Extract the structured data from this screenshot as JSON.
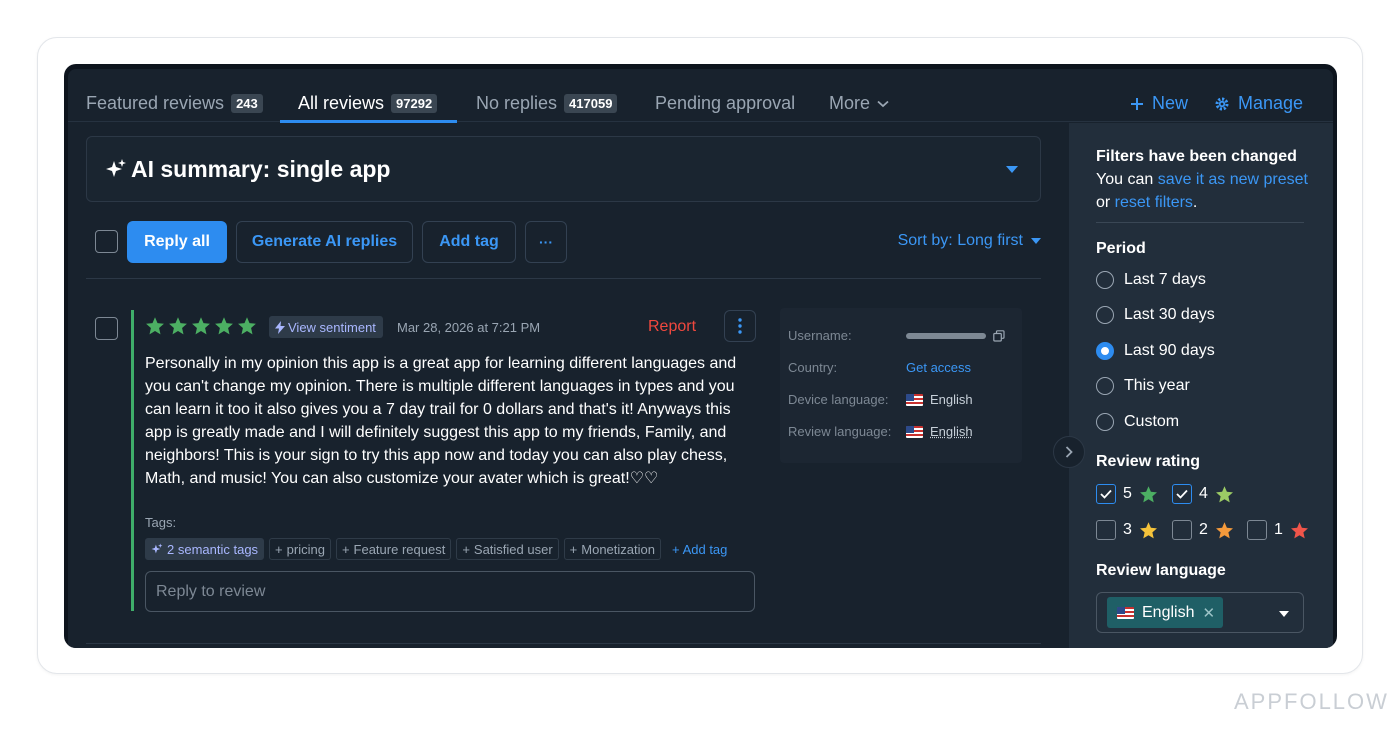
{
  "tabs": [
    {
      "label": "Featured reviews",
      "count": "243"
    },
    {
      "label": "All reviews",
      "count": "97292"
    },
    {
      "label": "No replies",
      "count": "417059"
    },
    {
      "label": "Pending approval"
    },
    {
      "label": "More"
    }
  ],
  "actions": {
    "new": "New",
    "manage": "Manage"
  },
  "ai_summary": {
    "title": "AI summary: single app"
  },
  "toolbar": {
    "reply_all": "Reply all",
    "generate": "Generate AI replies",
    "add_tag": "Add tag",
    "more": "···",
    "sort": "Sort by: Long first"
  },
  "review": {
    "rating": 5,
    "sentiment": "View sentiment",
    "date": "Mar 28, 2026 at 7:21 PM",
    "report": "Report",
    "text": "Personally in my opinion this app is a great app for learning different languages and you can't change my opinion. There is multiple different languages in types and you can learn it too it also gives you a 7 day trail for 0 dollars and that's it! Anyways this app is greatly made and I will definitely suggest this app to my friends, Family, and neighbors! This is your sign to try this app now and today you can also play chess, Math, and music! You can also customize your avater which is great!♡♡",
    "tags_label": "Tags:",
    "tags": {
      "semantic": "2 semantic tags",
      "items": [
        "pricing",
        "Feature request",
        "Satisfied user",
        "Monetization"
      ],
      "add": "Add tag"
    },
    "reply_placeholder": "Reply to review"
  },
  "meta": {
    "username_label": "Username:",
    "country_label": "Country:",
    "country_value": "Get access",
    "device_language_label": "Device language:",
    "device_language_value": "English",
    "review_language_label": "Review language:",
    "review_language_value": "English"
  },
  "sidebar": {
    "notice_title": "Filters have been changed",
    "notice_prefix": "You can ",
    "notice_link1": "save it as new preset",
    "notice_or": "or ",
    "notice_link2": "reset filters",
    "notice_end": ".",
    "period_title": "Period",
    "periods": [
      "Last 7 days",
      "Last 30 days",
      "Last 90 days",
      "This year",
      "Custom"
    ],
    "period_selected": "Last 90 days",
    "rating_title": "Review rating",
    "ratings": [
      {
        "value": "5",
        "checked": true,
        "color": "#4caf63"
      },
      {
        "value": "4",
        "checked": true,
        "color": "#9ccc65"
      },
      {
        "value": "3",
        "checked": false,
        "color": "#f5c33b"
      },
      {
        "value": "2",
        "checked": false,
        "color": "#f59a3b"
      },
      {
        "value": "1",
        "checked": false,
        "color": "#f0554a"
      }
    ],
    "language_title": "Review language",
    "language_selected": "English"
  },
  "watermark": "APPFOLLOW",
  "colors": {
    "accent": "#2d8cf0",
    "star_green": "#4caf63",
    "report_red": "#f0483e"
  }
}
